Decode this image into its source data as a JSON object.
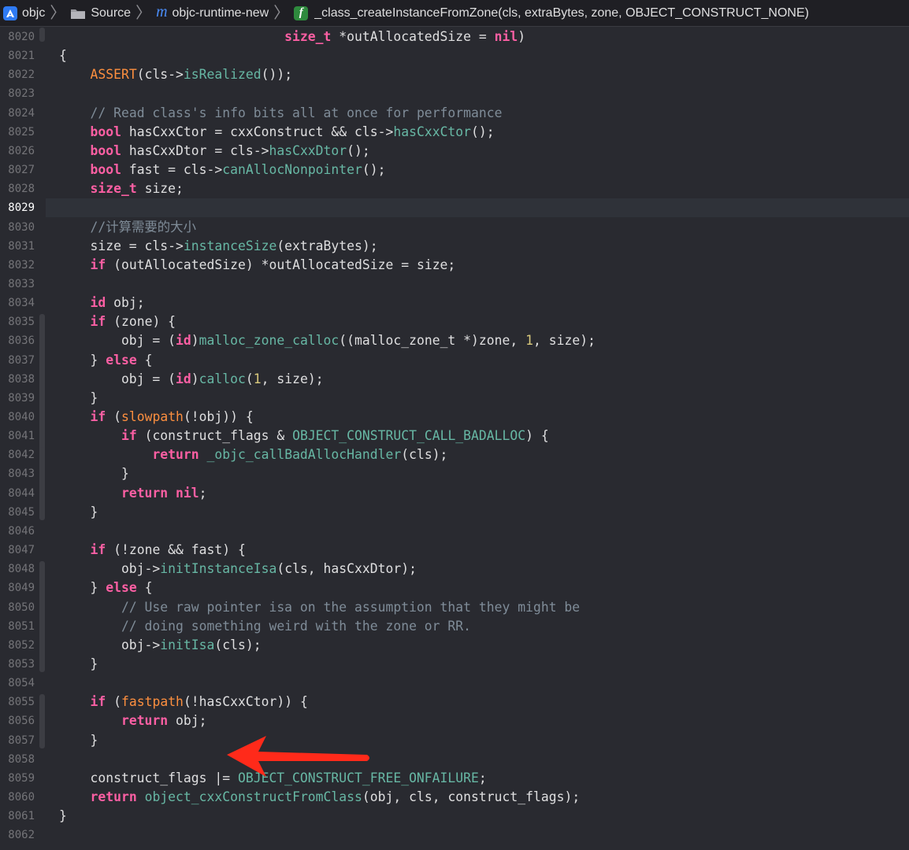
{
  "jumpbar": {
    "items": [
      {
        "label": "objc",
        "icon": "app-icon"
      },
      {
        "label": "Source",
        "icon": "folder-icon"
      },
      {
        "label": "objc-runtime-new",
        "icon": "m-source-icon"
      },
      {
        "label": "_class_createInstanceFromZone(cls, extraBytes, zone, OBJECT_CONSTRUCT_NONE)",
        "icon": "function-icon"
      }
    ],
    "separator": "〉"
  },
  "editor": {
    "current_line": "8029",
    "lines": [
      {
        "no": "8020",
        "tokens": [
          {
            "t": "                             "
          },
          {
            "t": "size_t",
            "c": "kw"
          },
          {
            "t": " *outAllocatedSize = "
          },
          {
            "t": "nil",
            "c": "kw"
          },
          {
            "t": ")"
          }
        ]
      },
      {
        "no": "8021",
        "tokens": [
          {
            "t": "{"
          }
        ]
      },
      {
        "no": "8022",
        "tokens": [
          {
            "t": "    "
          },
          {
            "t": "ASSERT",
            "c": "mac"
          },
          {
            "t": "(cls->"
          },
          {
            "t": "isRealized",
            "c": "fn"
          },
          {
            "t": "());"
          }
        ]
      },
      {
        "no": "8023",
        "tokens": []
      },
      {
        "no": "8024",
        "tokens": [
          {
            "t": "    "
          },
          {
            "t": "// Read class's info bits all at once for performance",
            "c": "cm"
          }
        ]
      },
      {
        "no": "8025",
        "tokens": [
          {
            "t": "    "
          },
          {
            "t": "bool",
            "c": "kw"
          },
          {
            "t": " hasCxxCtor = cxxConstruct && cls->"
          },
          {
            "t": "hasCxxCtor",
            "c": "fn"
          },
          {
            "t": "();"
          }
        ]
      },
      {
        "no": "8026",
        "tokens": [
          {
            "t": "    "
          },
          {
            "t": "bool",
            "c": "kw"
          },
          {
            "t": " hasCxxDtor = cls->"
          },
          {
            "t": "hasCxxDtor",
            "c": "fn"
          },
          {
            "t": "();"
          }
        ]
      },
      {
        "no": "8027",
        "tokens": [
          {
            "t": "    "
          },
          {
            "t": "bool",
            "c": "kw"
          },
          {
            "t": " fast = cls->"
          },
          {
            "t": "canAllocNonpointer",
            "c": "fn"
          },
          {
            "t": "();"
          }
        ]
      },
      {
        "no": "8028",
        "tokens": [
          {
            "t": "    "
          },
          {
            "t": "size_t",
            "c": "kw"
          },
          {
            "t": " size;"
          }
        ]
      },
      {
        "no": "8029",
        "tokens": []
      },
      {
        "no": "8030",
        "tokens": [
          {
            "t": "    "
          },
          {
            "t": "//计算需要的大小",
            "c": "cm"
          }
        ]
      },
      {
        "no": "8031",
        "tokens": [
          {
            "t": "    size = cls->"
          },
          {
            "t": "instanceSize",
            "c": "fn"
          },
          {
            "t": "(extraBytes);"
          }
        ]
      },
      {
        "no": "8032",
        "tokens": [
          {
            "t": "    "
          },
          {
            "t": "if",
            "c": "kw"
          },
          {
            "t": " (outAllocatedSize) *outAllocatedSize = size;"
          }
        ]
      },
      {
        "no": "8033",
        "tokens": []
      },
      {
        "no": "8034",
        "tokens": [
          {
            "t": "    "
          },
          {
            "t": "id",
            "c": "kw"
          },
          {
            "t": " obj;"
          }
        ]
      },
      {
        "no": "8035",
        "tokens": [
          {
            "t": "    "
          },
          {
            "t": "if",
            "c": "kw"
          },
          {
            "t": " (zone) {"
          }
        ]
      },
      {
        "no": "8036",
        "tokens": [
          {
            "t": "        obj = ("
          },
          {
            "t": "id",
            "c": "kw"
          },
          {
            "t": ")"
          },
          {
            "t": "malloc_zone_calloc",
            "c": "fn"
          },
          {
            "t": "((malloc_zone_t *)zone, "
          },
          {
            "t": "1",
            "c": "num"
          },
          {
            "t": ", size);"
          }
        ]
      },
      {
        "no": "8037",
        "tokens": [
          {
            "t": "    } "
          },
          {
            "t": "else",
            "c": "kw"
          },
          {
            "t": " {"
          }
        ]
      },
      {
        "no": "8038",
        "tokens": [
          {
            "t": "        obj = ("
          },
          {
            "t": "id",
            "c": "kw"
          },
          {
            "t": ")"
          },
          {
            "t": "calloc",
            "c": "fn"
          },
          {
            "t": "("
          },
          {
            "t": "1",
            "c": "num"
          },
          {
            "t": ", size);"
          }
        ]
      },
      {
        "no": "8039",
        "tokens": [
          {
            "t": "    }"
          }
        ]
      },
      {
        "no": "8040",
        "tokens": [
          {
            "t": "    "
          },
          {
            "t": "if",
            "c": "kw"
          },
          {
            "t": " ("
          },
          {
            "t": "slowpath",
            "c": "mac"
          },
          {
            "t": "(!obj)) {"
          }
        ]
      },
      {
        "no": "8041",
        "tokens": [
          {
            "t": "        "
          },
          {
            "t": "if",
            "c": "kw"
          },
          {
            "t": " (construct_flags & "
          },
          {
            "t": "OBJECT_CONSTRUCT_CALL_BADALLOC",
            "c": "fn"
          },
          {
            "t": ") {"
          }
        ]
      },
      {
        "no": "8042",
        "tokens": [
          {
            "t": "            "
          },
          {
            "t": "return",
            "c": "kw"
          },
          {
            "t": " "
          },
          {
            "t": "_objc_callBadAllocHandler",
            "c": "fn"
          },
          {
            "t": "(cls);"
          }
        ]
      },
      {
        "no": "8043",
        "tokens": [
          {
            "t": "        }"
          }
        ]
      },
      {
        "no": "8044",
        "tokens": [
          {
            "t": "        "
          },
          {
            "t": "return",
            "c": "kw"
          },
          {
            "t": " "
          },
          {
            "t": "nil",
            "c": "kw"
          },
          {
            "t": ";"
          }
        ]
      },
      {
        "no": "8045",
        "tokens": [
          {
            "t": "    }"
          }
        ]
      },
      {
        "no": "8046",
        "tokens": []
      },
      {
        "no": "8047",
        "tokens": [
          {
            "t": "    "
          },
          {
            "t": "if",
            "c": "kw"
          },
          {
            "t": " (!zone && fast) {"
          }
        ]
      },
      {
        "no": "8048",
        "tokens": [
          {
            "t": "        obj->"
          },
          {
            "t": "initInstanceIsa",
            "c": "fn"
          },
          {
            "t": "(cls, hasCxxDtor);"
          }
        ]
      },
      {
        "no": "8049",
        "tokens": [
          {
            "t": "    } "
          },
          {
            "t": "else",
            "c": "kw"
          },
          {
            "t": " {"
          }
        ]
      },
      {
        "no": "8050",
        "tokens": [
          {
            "t": "        "
          },
          {
            "t": "// Use raw pointer isa on the assumption that they might be",
            "c": "cm"
          }
        ]
      },
      {
        "no": "8051",
        "tokens": [
          {
            "t": "        "
          },
          {
            "t": "// doing something weird with the zone or RR.",
            "c": "cm"
          }
        ]
      },
      {
        "no": "8052",
        "tokens": [
          {
            "t": "        obj->"
          },
          {
            "t": "initIsa",
            "c": "fn"
          },
          {
            "t": "(cls);"
          }
        ]
      },
      {
        "no": "8053",
        "tokens": [
          {
            "t": "    }"
          }
        ]
      },
      {
        "no": "8054",
        "tokens": []
      },
      {
        "no": "8055",
        "tokens": [
          {
            "t": "    "
          },
          {
            "t": "if",
            "c": "kw"
          },
          {
            "t": " ("
          },
          {
            "t": "fastpath",
            "c": "mac"
          },
          {
            "t": "(!hasCxxCtor)) {"
          }
        ]
      },
      {
        "no": "8056",
        "tokens": [
          {
            "t": "        "
          },
          {
            "t": "return",
            "c": "kw"
          },
          {
            "t": " obj;"
          }
        ]
      },
      {
        "no": "8057",
        "tokens": [
          {
            "t": "    }"
          }
        ]
      },
      {
        "no": "8058",
        "tokens": []
      },
      {
        "no": "8059",
        "tokens": [
          {
            "t": "    construct_flags |= "
          },
          {
            "t": "OBJECT_CONSTRUCT_FREE_ONFAILURE",
            "c": "fn"
          },
          {
            "t": ";"
          }
        ]
      },
      {
        "no": "8060",
        "tokens": [
          {
            "t": "    "
          },
          {
            "t": "return",
            "c": "kw"
          },
          {
            "t": " "
          },
          {
            "t": "object_cxxConstructFromClass",
            "c": "fn"
          },
          {
            "t": "(obj, cls, construct_flags);"
          }
        ]
      },
      {
        "no": "8061",
        "tokens": [
          {
            "t": "}"
          }
        ]
      },
      {
        "no": "8062",
        "tokens": []
      }
    ]
  },
  "colors": {
    "background": "#292a30",
    "keyword": "#fc5fa3",
    "macro": "#fd8f3f",
    "function": "#67b7a4",
    "comment": "#7f8c98",
    "number": "#d9c97c",
    "annotation_arrow": "#ff2a1a"
  }
}
